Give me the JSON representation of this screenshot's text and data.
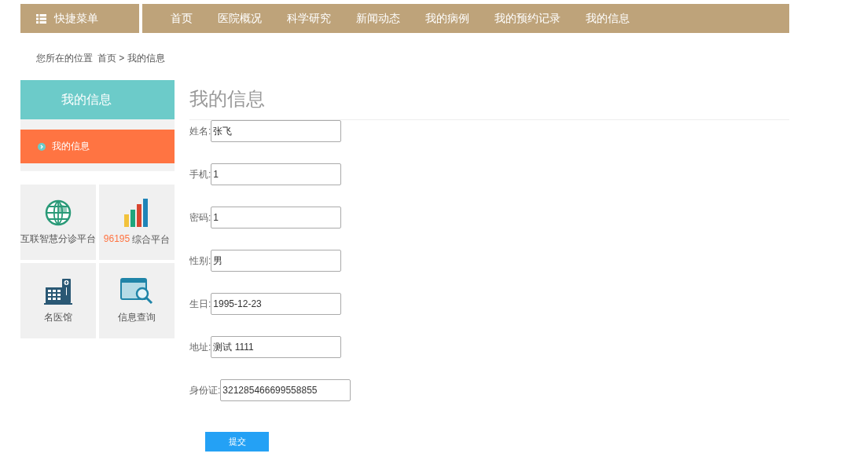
{
  "quick_menu": {
    "label": "快捷菜单"
  },
  "nav": [
    {
      "label": "首页",
      "selected": false
    },
    {
      "label": "医院概况",
      "selected": false
    },
    {
      "label": "科学研究",
      "selected": false
    },
    {
      "label": "新闻动态",
      "selected": false
    },
    {
      "label": "我的病例",
      "selected": false
    },
    {
      "label": "我的预约记录",
      "selected": false
    },
    {
      "label": "我的信息",
      "selected": false
    }
  ],
  "breadcrumb": {
    "prefix": "您所在的位置",
    "path": "首页 > 我的信息"
  },
  "sidebar": {
    "title": "我的信息",
    "items": [
      {
        "label": "我的信息",
        "selected": true
      }
    ],
    "tiles": [
      {
        "kind": "globe",
        "label": "互联智慧分诊平台"
      },
      {
        "kind": "bars",
        "number": "96195",
        "label": "综合平台"
      },
      {
        "kind": "hospital",
        "label": "名医馆"
      },
      {
        "kind": "search",
        "label": "信息查询"
      }
    ]
  },
  "page_title": "我的信息",
  "form": {
    "fields": [
      {
        "label": "姓名:",
        "value": "张飞"
      },
      {
        "label": "手机:",
        "value": "1"
      },
      {
        "label": "密码:",
        "value": "1"
      },
      {
        "label": "性别:",
        "value": "男"
      },
      {
        "label": "生日:",
        "value": "1995-12-23"
      },
      {
        "label": "地址:",
        "value": "测试 1111"
      },
      {
        "label": "身份证:",
        "value": "321285466699558855"
      }
    ],
    "submit": "提交"
  }
}
